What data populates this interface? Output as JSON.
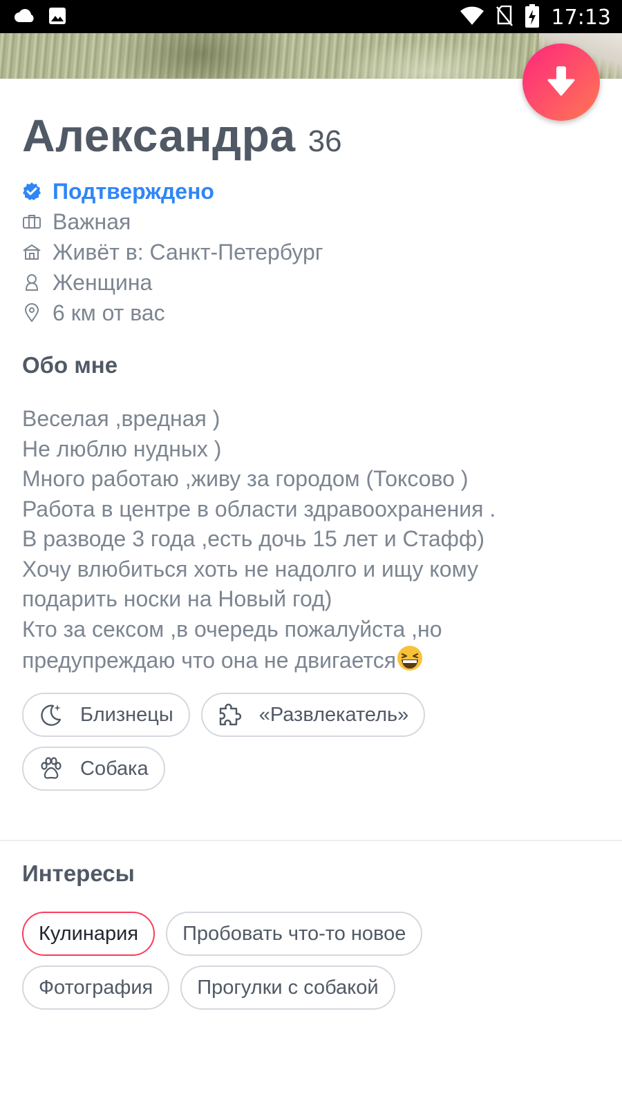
{
  "status_bar": {
    "time": "17:13",
    "left_icons": [
      "cloud-icon",
      "image-icon"
    ],
    "right_icons": [
      "wifi-icon",
      "no-sim-icon",
      "battery-charging-icon"
    ]
  },
  "profile": {
    "name": "Александра",
    "age": "36",
    "verified_label": "Подтверждено",
    "job": "Важная",
    "lives_in": "Живёт в: Санкт-Петербург",
    "gender": "Женщина",
    "distance": "6 км от вас"
  },
  "about": {
    "title": "Обо мне",
    "lines": [
      "Веселая ,вредная )",
      "Не люблю нудных )",
      "Много работаю ,живу за городом (Токсово )",
      "Работа в центре в области здравоохранения .",
      "В разводе 3 года ,есть дочь 15 лет и Стафф)",
      "Хочу влюбиться хоть не надолго и ищу кому",
      "подарить носки на Новый год)",
      "Кто за сексом ,в очередь пожалуйста ,но",
      "предупреждаю что она не двигается"
    ],
    "emoji": "grinning-squinting-face-emoji"
  },
  "lifestyle_chips": [
    {
      "icon": "moon-stars-icon",
      "label": "Близнецы"
    },
    {
      "icon": "puzzle-icon",
      "label": "«Развлекатель»"
    },
    {
      "icon": "paw-icon",
      "label": "Собака"
    }
  ],
  "interests": {
    "title": "Интересы",
    "items": [
      {
        "label": "Кулинария",
        "selected": true
      },
      {
        "label": "Пробовать что-то новое",
        "selected": false
      },
      {
        "label": "Фотография",
        "selected": false
      },
      {
        "label": "Прогулки с собакой",
        "selected": false
      }
    ]
  },
  "colors": {
    "accent_gradient_start": "#fd267d",
    "accent_gradient_end": "#ff7854",
    "verified_blue": "#2f86f6",
    "text_dark": "#505965",
    "text_muted": "#7c8591",
    "chip_border": "#d4d8de",
    "selected_border": "#fd3a5c"
  },
  "fab": {
    "icon": "arrow-down-icon"
  }
}
